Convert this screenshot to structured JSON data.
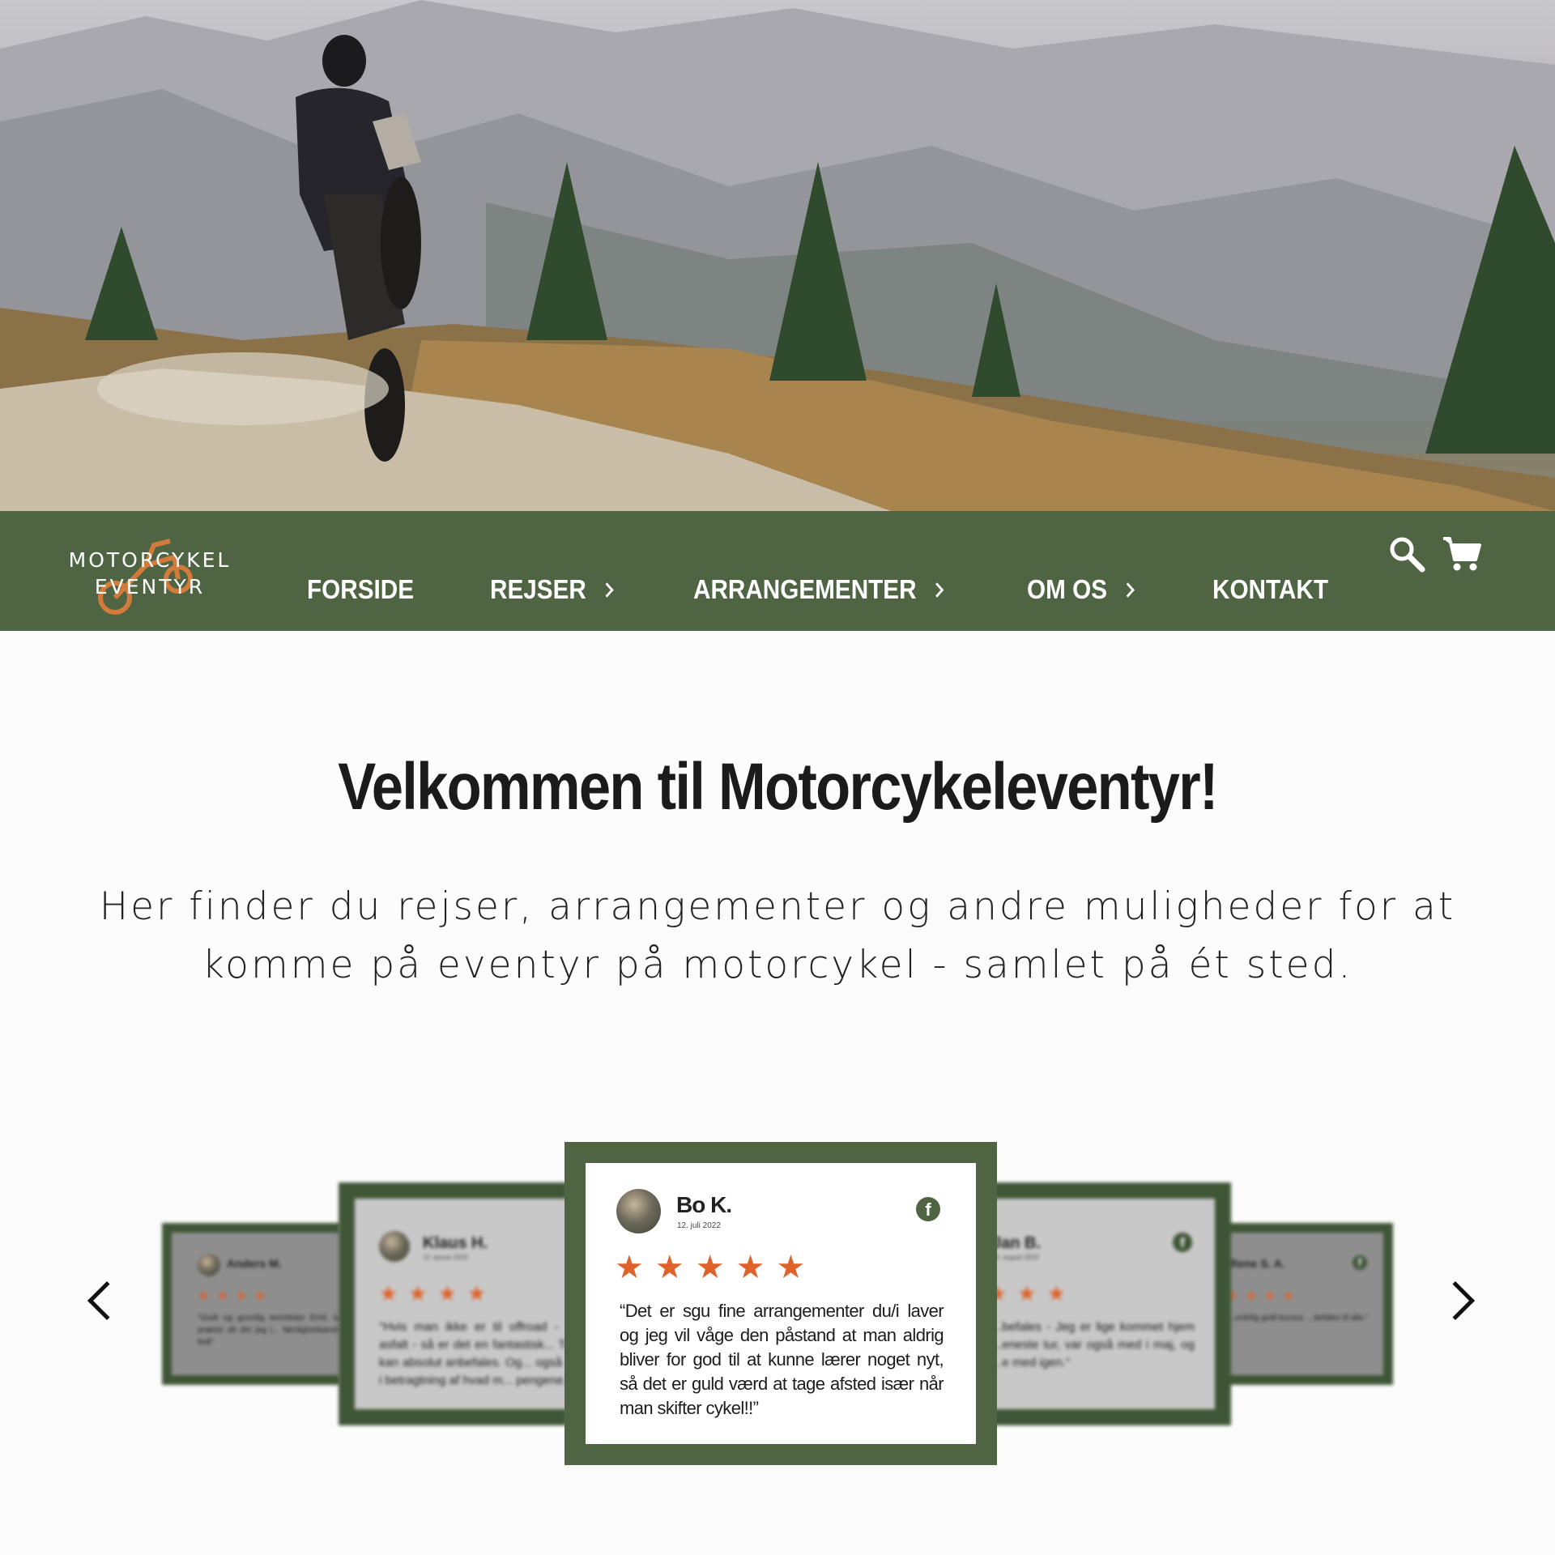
{
  "nav": {
    "logo_line1": "MOTORCYKEL",
    "logo_line2": "EVENTYR",
    "items": [
      {
        "label": "FORSIDE",
        "has_submenu": false
      },
      {
        "label": "REJSER",
        "has_submenu": true
      },
      {
        "label": "ARRANGEMENTER",
        "has_submenu": true
      },
      {
        "label": "OM OS",
        "has_submenu": true
      },
      {
        "label": "KONTAKT",
        "has_submenu": false
      }
    ],
    "icons": [
      "search-icon",
      "cart-icon"
    ]
  },
  "welcome": {
    "title": "Velkommen til Motorcykeleventyr!",
    "subtitle": "Her finder du rejser, arrangementer og andre muligheder for at komme på eventyr på motorcykel - samlet på ét sted."
  },
  "reviews": [
    {
      "name": "Anders M.",
      "date": "",
      "stars": 4,
      "text": "\"Godt og grundig teoretiske Emil, ta... det. Der var praksis alt det jeg i... færdighedsøvelser nydende, så fedt\"",
      "partial": true
    },
    {
      "name": "Klaus H.",
      "date": "12. januar 2023",
      "stars": 4,
      "text": "\"Hvis man ikke er til offroad - med asfalt - så er det en fantastisk... Turen kan absolut anbefales. Og... også god, i betragtning af hvad m... pengene.\"",
      "partial": true
    },
    {
      "name": "Bo K.",
      "date": "12. juli 2022",
      "stars": 5,
      "text": "“Det er sgu fine arrangementer du/i laver og jeg vil våge den påstand at man aldrig bliver for god til at kunne lærer noget nyt, så det er guld værd at tage afsted især når man skifter cykel!!”",
      "partial": false
    },
    {
      "name": "Jan B.",
      "date": "10. august 2023",
      "stars": 3,
      "text": "...befales - Jeg er lige kommet hjem ...eneste tur, var også med i maj, og ...e med igen.\"",
      "partial": true
    },
    {
      "name": "Rene S. A.",
      "date": "",
      "stars": 4,
      "text": "...ordelig godt kursus. ...befales til alle.\"",
      "partial": true
    }
  ],
  "star_glyph": "★",
  "colors": {
    "nav_green": "#4e6443",
    "star_orange": "#e0622b",
    "logo_orange": "#d47a3a"
  }
}
